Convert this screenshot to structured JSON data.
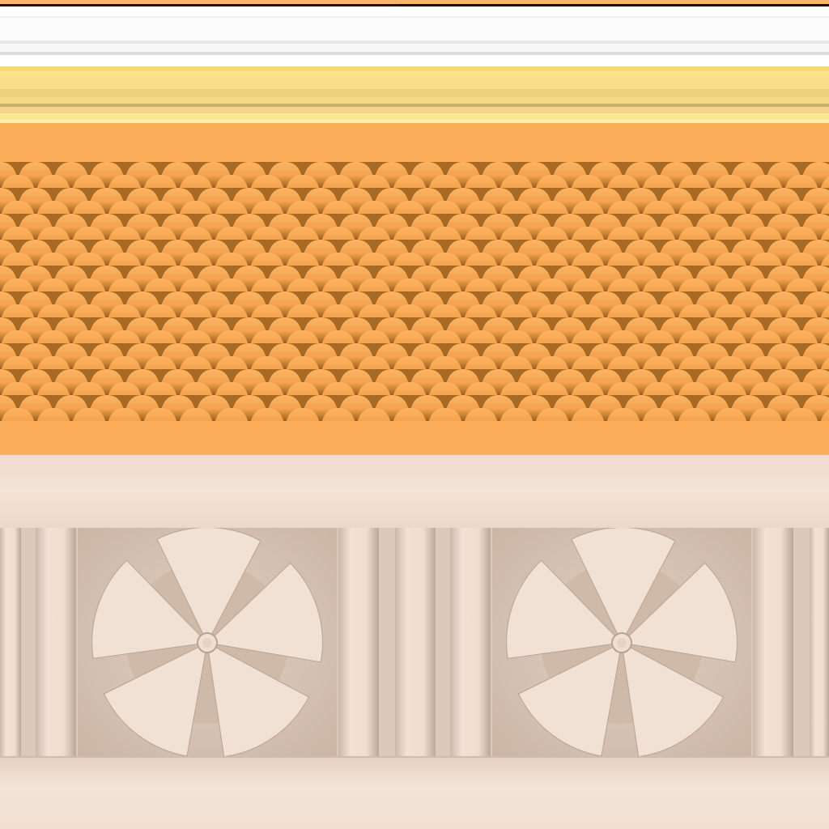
{
  "title": "",
  "colors": {
    "orange": "#fbad5a",
    "scale_light": "#fbab57",
    "scale_dark": "#a86a22",
    "yellow": "#f8de86",
    "stone": "#f1e0d2",
    "stone_shadow": "#c9b5a6"
  },
  "panels": [
    {
      "motif": "rosette",
      "petals": 5
    },
    {
      "motif": "rosette",
      "petals": 5
    }
  ],
  "bands": [
    "top-strip",
    "white-molding",
    "yellow-molding",
    "scale-pattern",
    "stone-frieze"
  ]
}
